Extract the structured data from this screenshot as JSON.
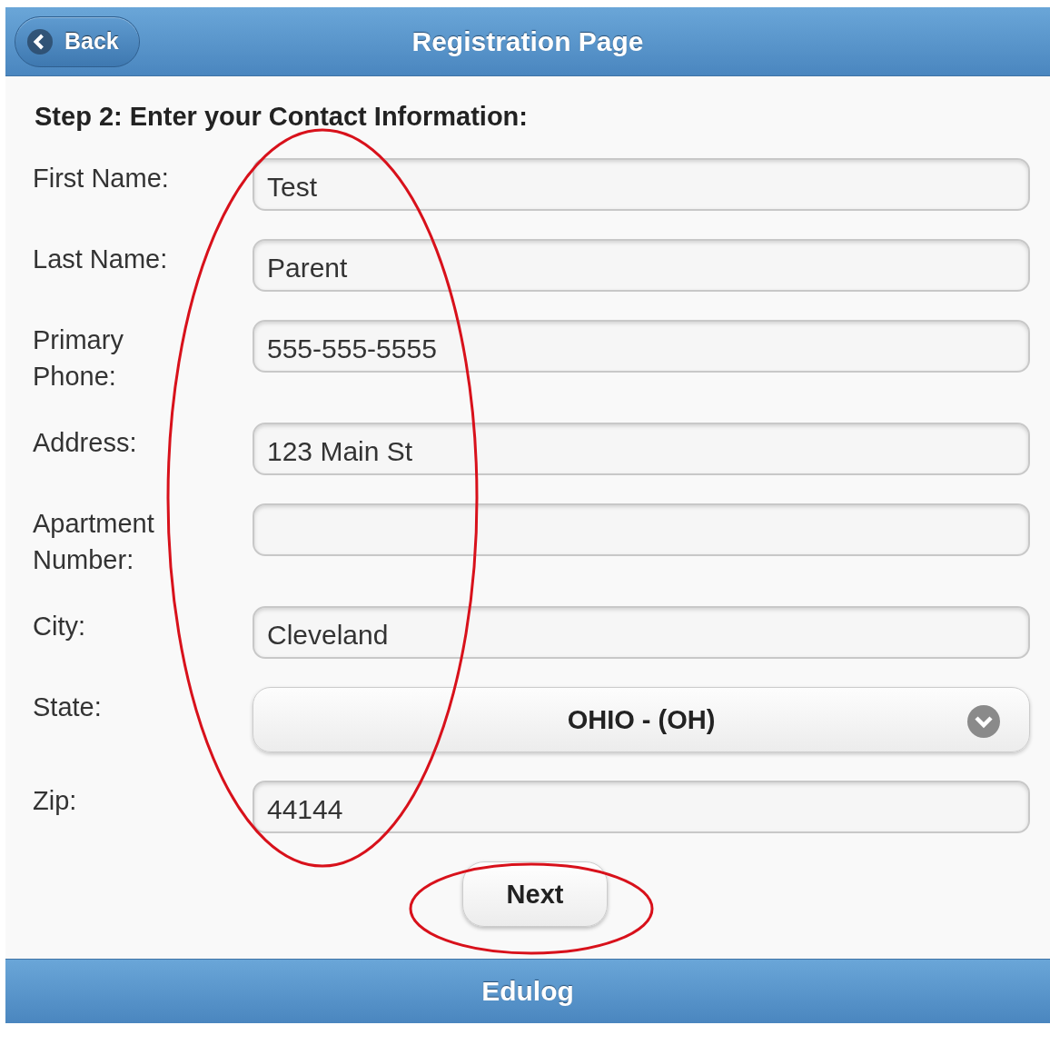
{
  "header": {
    "back_button": "Back",
    "title": "Registration Page"
  },
  "form": {
    "heading": "Step 2: Enter your Contact Information:",
    "fields": [
      {
        "label": "First Name:",
        "kind": "text",
        "value": "Test"
      },
      {
        "label": "Last Name:",
        "kind": "text",
        "value": "Parent"
      },
      {
        "label": "Primary Phone:",
        "kind": "text",
        "value": "555-555-5555"
      },
      {
        "label": "Address:",
        "kind": "text",
        "value": "123 Main St"
      },
      {
        "label": "Apartment Number:",
        "kind": "text"
      },
      {
        "label": "City:",
        "kind": "text",
        "value": "Cleveland"
      },
      {
        "label": "State:",
        "kind": "select",
        "value": "OHIO - (OH)"
      },
      {
        "label": "Zip:",
        "kind": "text",
        "value": "44144"
      }
    ],
    "next_button": "Next"
  },
  "footer": {
    "title": "Edulog"
  }
}
